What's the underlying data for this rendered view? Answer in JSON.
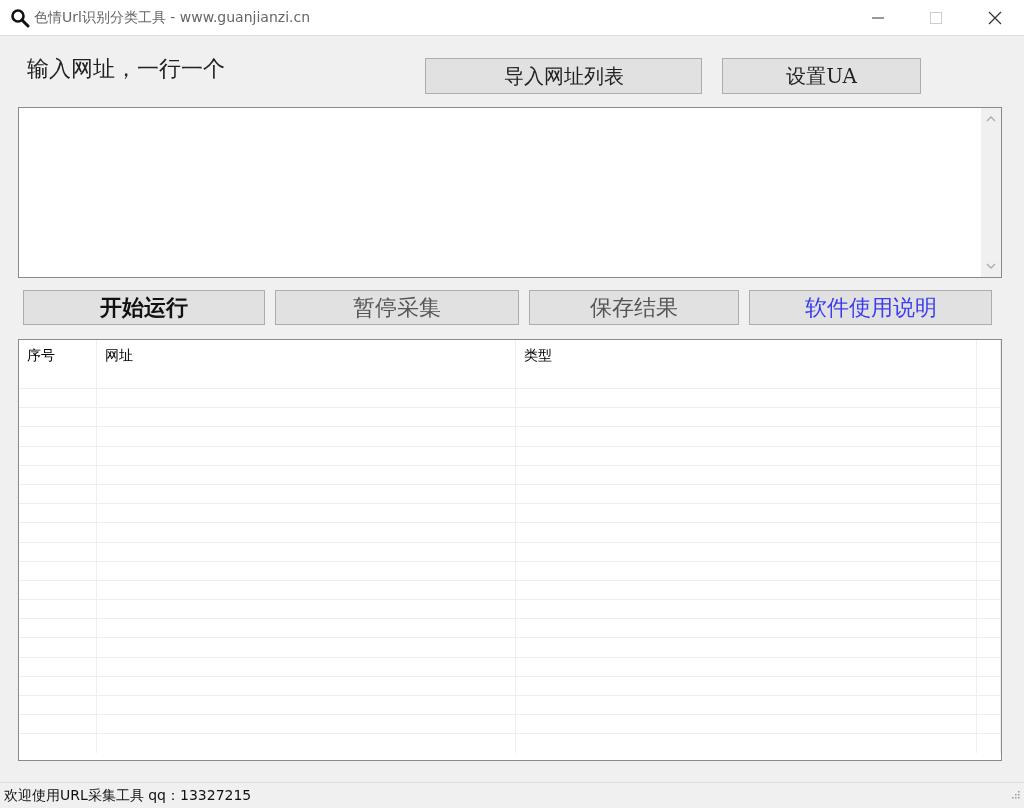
{
  "window": {
    "title": "色情Url识别分类工具 - www.guanjianzi.cn"
  },
  "input_label": "输入网址，一行一个",
  "top_buttons": [
    "导入网址列表",
    "设置UA"
  ],
  "action_buttons": [
    {
      "label": "开始运行",
      "kind": "primary"
    },
    {
      "label": "暂停采集",
      "kind": "muted"
    },
    {
      "label": "保存结果",
      "kind": "muted"
    },
    {
      "label": "软件使用说明",
      "kind": "link"
    }
  ],
  "table": {
    "columns": [
      "序号",
      "网址",
      "类型"
    ]
  },
  "status_bar": "欢迎使用URL采集工具 qq：13327215"
}
